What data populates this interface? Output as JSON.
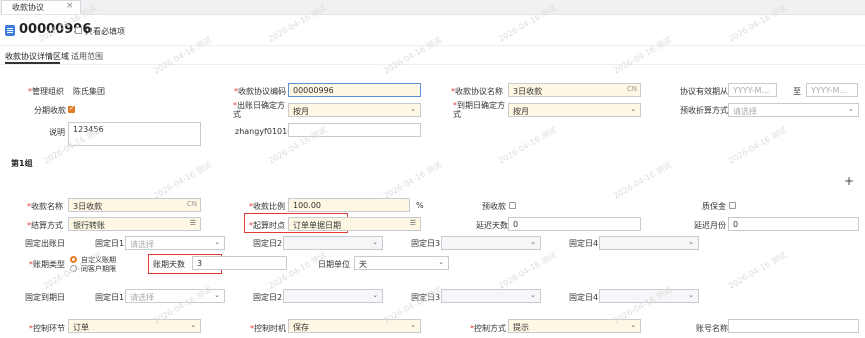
{
  "tabs": [
    {
      "label": "收款协议",
      "close": "×"
    }
  ],
  "header": {
    "doc_no": "00000996",
    "only_view_checkbox": "只看必填项"
  },
  "subtabs": [
    {
      "label": "收款协议详情区域"
    },
    {
      "label": "适用范围"
    }
  ],
  "form": {
    "org_label": "管理组织",
    "org_value": "陈氏集团",
    "code_label": "收款协议编码",
    "code_value": "00000996",
    "name_label": "收款协议名称",
    "name_value": "3日收款",
    "name_lang": "CN",
    "valid_label": "协议有效期从",
    "valid_from_placeholder": "YYYY-M…",
    "valid_to_label": "至",
    "valid_to_placeholder": "YYYY-M…",
    "installment_label": "分期收款",
    "bill_date_label": "出账日确定方式",
    "bill_date_value": "按月",
    "due_date_label": "到期日确定方式",
    "due_date_value": "按月",
    "prepay_label": "预收折算方式",
    "prepay_placeholder": "请选择",
    "desc_label": "说明",
    "desc_value": "123456",
    "user_label": "zhangyf01016"
  },
  "group": {
    "title": "第1组",
    "add_icon": "+",
    "receipt_name_label": "收款名称",
    "receipt_name_value": "3日收款",
    "receipt_name_lang": "CN",
    "receipt_ratio_label": "收款比例",
    "receipt_ratio_value": "100.00",
    "receipt_ratio_unit": "%",
    "prepaid_label": "预收款",
    "deposit_label": "质保金",
    "settle_label": "结算方式",
    "settle_value": "银行转账",
    "start_point_label": "起算时点",
    "start_point_value": "订单单据日期",
    "delay_days_label": "延迟天数",
    "delay_days_value": "0",
    "delay_months_label": "延迟月份",
    "delay_months_value": "0",
    "fixed_bill_label": "固定出账日",
    "fixed_day1_label": "固定日1",
    "fixed_day1_placeholder": "请选择",
    "fixed_day2_label": "固定日2",
    "fixed_day3_label": "固定日3",
    "fixed_day4_label": "固定日4",
    "period_type_label": "账期类型",
    "period_opt1": "自定义账期",
    "period_opt2": "同客户期限",
    "period_days_label": "账期天数",
    "period_days_value": "3",
    "date_unit_label": "日期单位",
    "date_unit_value": "天",
    "fixed_due_label": "固定到期日",
    "fixed_due1_label": "固定日1",
    "fixed_due1_placeholder": "请选择",
    "fixed_due2_label": "固定日2",
    "fixed_due3_label": "固定日3",
    "fixed_due4_label": "固定日4",
    "control_step_label": "控制环节",
    "control_step_value": "订单",
    "control_time_label": "控制时机",
    "control_time_value": "保存",
    "control_mode_label": "控制方式",
    "control_mode_value": "提示",
    "account_name_label": "账号名称"
  },
  "watermark": "2026-04-16 测试",
  "colors": {
    "required": "#e53935",
    "highlight_box": "#e53935",
    "accent": "#e37a24",
    "required_field_bg": "#fdf7e3"
  }
}
